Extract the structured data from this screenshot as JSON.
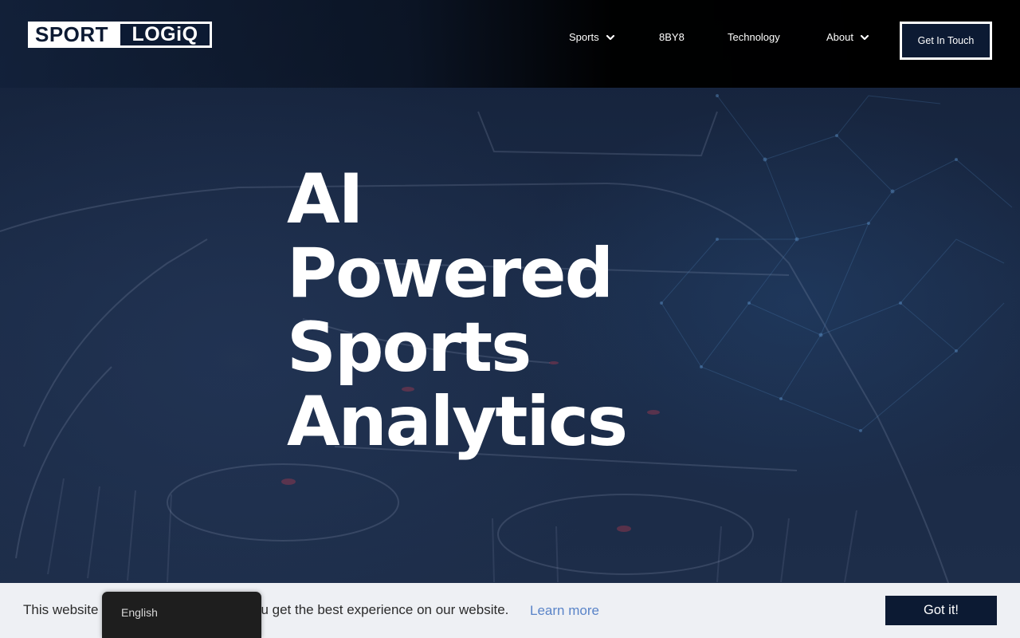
{
  "brand": {
    "logo_left": "SPORT",
    "logo_right": "LOGiQ"
  },
  "nav": {
    "items": [
      {
        "label": "Sports",
        "has_dropdown": true
      },
      {
        "label": "8BY8",
        "has_dropdown": false
      },
      {
        "label": "Technology",
        "has_dropdown": false
      },
      {
        "label": "About",
        "has_dropdown": true
      }
    ],
    "cta_label": "Get In Touch"
  },
  "hero": {
    "headline_lines": [
      "AI",
      "Powered",
      "Sports",
      "Analytics"
    ]
  },
  "cookie_banner": {
    "text_start": "This website",
    "text_end": "ou get the best experience on our website.",
    "learn_more": "Learn more",
    "accept_label": "Got it!"
  },
  "language_switcher": {
    "current": "English"
  },
  "icons": {
    "dropdown": "chevron-down-icon"
  },
  "colors": {
    "brand_navy": "#0c1a33",
    "link_blue": "#5a84c8",
    "cookie_bg": "#eef0f4"
  }
}
